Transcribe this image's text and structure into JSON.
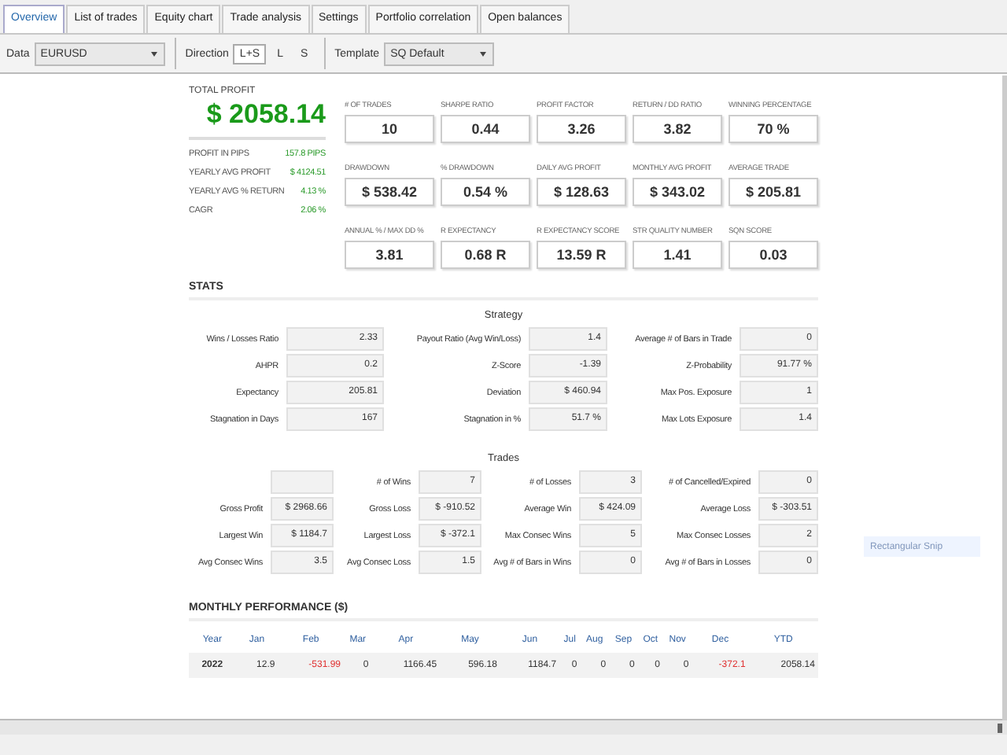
{
  "tabs": [
    {
      "label": "Overview",
      "selected": true
    },
    {
      "label": "List of trades",
      "selected": false
    },
    {
      "label": "Equity chart",
      "selected": false
    },
    {
      "label": "Trade analysis",
      "selected": false
    },
    {
      "label": "Settings",
      "selected": false
    },
    {
      "label": "Portfolio correlation",
      "selected": false
    },
    {
      "label": "Open balances",
      "selected": false
    }
  ],
  "toolbar": {
    "data_label": "Data",
    "data_value": "EURUSD",
    "direction_label": "Direction",
    "directions": [
      {
        "label": "L+S",
        "selected": true
      },
      {
        "label": "L",
        "selected": false
      },
      {
        "label": "S",
        "selected": false
      }
    ],
    "template_label": "Template",
    "template_value": "SQ Default"
  },
  "total_profit": {
    "label": "TOTAL PROFIT",
    "value": "$ 2058.14"
  },
  "summary": [
    {
      "label": "PROFIT IN PIPS",
      "value": "157.8 PIPS"
    },
    {
      "label": "YEARLY AVG PROFIT",
      "value": "$ 4124.51"
    },
    {
      "label": "YEARLY AVG % RETURN",
      "value": "4.13 %"
    },
    {
      "label": "CAGR",
      "value": "2.06 %"
    }
  ],
  "metrics": [
    {
      "label": "# OF TRADES",
      "value": "10"
    },
    {
      "label": "SHARPE RATIO",
      "value": "0.44"
    },
    {
      "label": "PROFIT FACTOR",
      "value": "3.26"
    },
    {
      "label": "RETURN / DD RATIO",
      "value": "3.82"
    },
    {
      "label": "WINNING PERCENTAGE",
      "value": "70 %"
    },
    {
      "label": "DRAWDOWN",
      "value": "$ 538.42"
    },
    {
      "label": "% DRAWDOWN",
      "value": "0.54 %"
    },
    {
      "label": "DAILY AVG PROFIT",
      "value": "$ 128.63"
    },
    {
      "label": "MONTHLY AVG PROFIT",
      "value": "$ 343.02"
    },
    {
      "label": "AVERAGE TRADE",
      "value": "$ 205.81"
    },
    {
      "label": "ANNUAL % / MAX DD %",
      "value": "3.81"
    },
    {
      "label": "R EXPECTANCY",
      "value": "0.68 R"
    },
    {
      "label": "R EXPECTANCY SCORE",
      "value": "13.59 R"
    },
    {
      "label": "STR QUALITY NUMBER",
      "value": "1.41"
    },
    {
      "label": "SQN SCORE",
      "value": "0.03"
    }
  ],
  "stats_heading": "STATS",
  "strategy": {
    "title": "Strategy",
    "rows": [
      [
        {
          "label": "Wins / Losses Ratio",
          "value": "2.33"
        },
        {
          "label": "Payout Ratio (Avg Win/Loss)",
          "value": "1.4"
        },
        {
          "label": "Average # of Bars in Trade",
          "value": "0"
        }
      ],
      [
        {
          "label": "AHPR",
          "value": "0.2"
        },
        {
          "label": "Z-Score",
          "value": "-1.39"
        },
        {
          "label": "Z-Probability",
          "value": "91.77 %"
        }
      ],
      [
        {
          "label": "Expectancy",
          "value": "205.81"
        },
        {
          "label": "Deviation",
          "value": "$ 460.94"
        },
        {
          "label": "Max Pos. Exposure",
          "value": "1"
        }
      ],
      [
        {
          "label": "Stagnation in Days",
          "value": "167"
        },
        {
          "label": "Stagnation in %",
          "value": "51.7 %"
        },
        {
          "label": "Max Lots Exposure",
          "value": "1.4"
        }
      ]
    ]
  },
  "trades": {
    "title": "Trades",
    "rows": [
      [
        {},
        {
          "label": "# of Wins",
          "value": "7"
        },
        {
          "label": "# of Losses",
          "value": "3"
        },
        {
          "label": "# of Cancelled/Expired",
          "value": "0"
        }
      ],
      [
        {
          "label": "Gross Profit",
          "value": "$ 2968.66"
        },
        {
          "label": "Gross Loss",
          "value": "$ -910.52"
        },
        {
          "label": "Average Win",
          "value": "$ 424.09"
        },
        {
          "label": "Average Loss",
          "value": "$ -303.51"
        }
      ],
      [
        {
          "label": "Largest Win",
          "value": "$ 1184.7"
        },
        {
          "label": "Largest Loss",
          "value": "$ -372.1"
        },
        {
          "label": "Max Consec Wins",
          "value": "5"
        },
        {
          "label": "Max Consec Losses",
          "value": "2"
        }
      ],
      [
        {
          "label": "Avg Consec Wins",
          "value": "3.5"
        },
        {
          "label": "Avg Consec Loss",
          "value": "1.5"
        },
        {
          "label": "Avg # of Bars in Wins",
          "value": "0"
        },
        {
          "label": "Avg # of Bars in Losses",
          "value": "0"
        }
      ]
    ]
  },
  "monthly": {
    "heading": "MONTHLY PERFORMANCE ($)",
    "columns": [
      "Year",
      "Jan",
      "Feb",
      "Mar",
      "Apr",
      "May",
      "Jun",
      "Jul",
      "Aug",
      "Sep",
      "Oct",
      "Nov",
      "Dec",
      "YTD"
    ],
    "rows": [
      [
        {
          "text": "2022",
          "negative": false
        },
        {
          "text": "12.9",
          "negative": false
        },
        {
          "text": "-531.99",
          "negative": true
        },
        {
          "text": "0",
          "negative": false
        },
        {
          "text": "1166.45",
          "negative": false
        },
        {
          "text": "596.18",
          "negative": false
        },
        {
          "text": "1184.7",
          "negative": false
        },
        {
          "text": "0",
          "negative": false
        },
        {
          "text": "0",
          "negative": false
        },
        {
          "text": "0",
          "negative": false
        },
        {
          "text": "0",
          "negative": false
        },
        {
          "text": "0",
          "negative": false
        },
        {
          "text": "-372.1",
          "negative": true
        },
        {
          "text": "2058.14",
          "negative": false
        }
      ]
    ]
  },
  "snip_hint": "Rectangular Snip"
}
